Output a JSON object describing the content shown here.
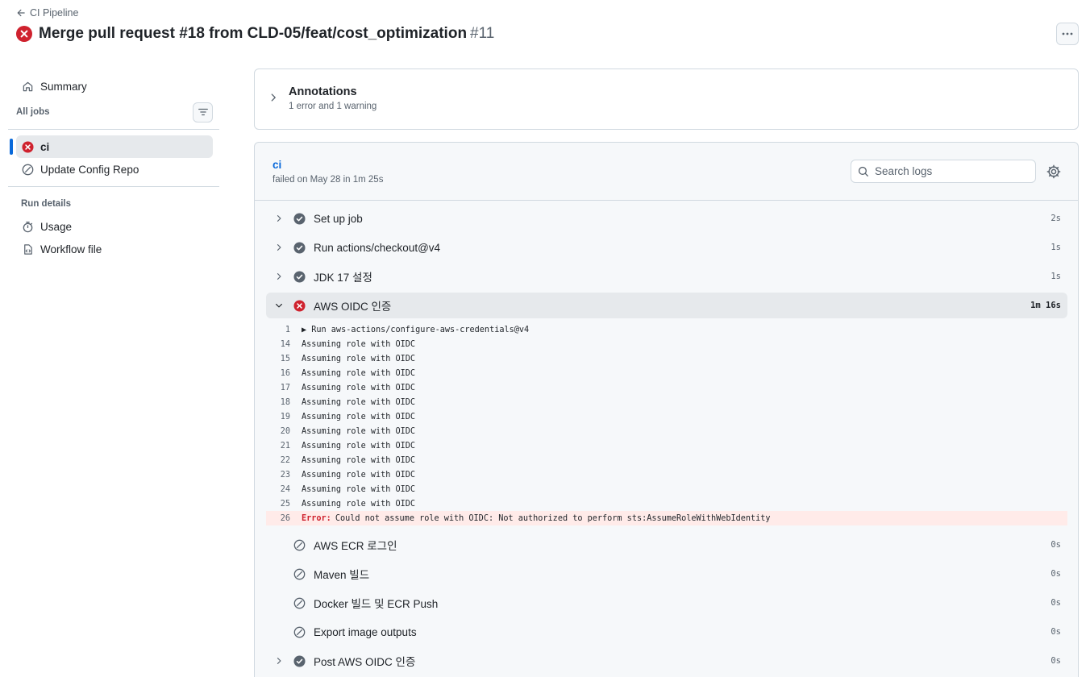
{
  "header": {
    "back_label": "CI Pipeline",
    "title": "Merge pull request #18 from CLD-05/feat/cost_optimization",
    "run_number": "#11"
  },
  "sidebar": {
    "summary_label": "Summary",
    "all_jobs_label": "All jobs",
    "jobs": [
      {
        "label": "ci",
        "status": "failed"
      },
      {
        "label": "Update Config Repo",
        "status": "skipped"
      }
    ],
    "run_details_label": "Run details",
    "details": [
      {
        "label": "Usage",
        "icon": "stopwatch-icon"
      },
      {
        "label": "Workflow file",
        "icon": "file-code-icon"
      }
    ]
  },
  "annotations": {
    "title": "Annotations",
    "subtitle": "1 error and 1 warning"
  },
  "job": {
    "name": "ci",
    "meta": "failed on May 28 in 1m 25s",
    "search_placeholder": "Search logs",
    "steps_before": [
      {
        "label": "Set up job",
        "time": "2s",
        "status": "success"
      },
      {
        "label": "Run actions/checkout@v4",
        "time": "1s",
        "status": "success"
      },
      {
        "label": "JDK 17 설정",
        "time": "1s",
        "status": "success"
      }
    ],
    "failed_step": {
      "label": "AWS OIDC 인증",
      "time": "1m 16s",
      "status": "failed"
    },
    "log": {
      "first": {
        "num": "1",
        "text": "▶ Run aws-actions/configure-aws-credentials@v4"
      },
      "repeated_text": "Assuming role with OIDC",
      "repeated_nums": [
        "14",
        "15",
        "16",
        "17",
        "18",
        "19",
        "20",
        "21",
        "22",
        "23",
        "24",
        "25"
      ],
      "error": {
        "num": "26",
        "keyword": "Error:",
        "text": "Could not assume role with OIDC: Not authorized to perform sts:AssumeRoleWithWebIdentity"
      }
    },
    "steps_after": [
      {
        "label": "AWS ECR 로그인",
        "time": "0s",
        "status": "skipped"
      },
      {
        "label": "Maven 빌드",
        "time": "0s",
        "status": "skipped"
      },
      {
        "label": "Docker 빌드 및 ECR Push",
        "time": "0s",
        "status": "skipped"
      },
      {
        "label": "Export image outputs",
        "time": "0s",
        "status": "skipped"
      },
      {
        "label": "Post AWS OIDC 인증",
        "time": "0s",
        "status": "success"
      }
    ]
  },
  "colors": {
    "failed": "#cf222e",
    "success": "#59636e",
    "accent": "#0969da",
    "error_bg": "#ffebe9"
  }
}
